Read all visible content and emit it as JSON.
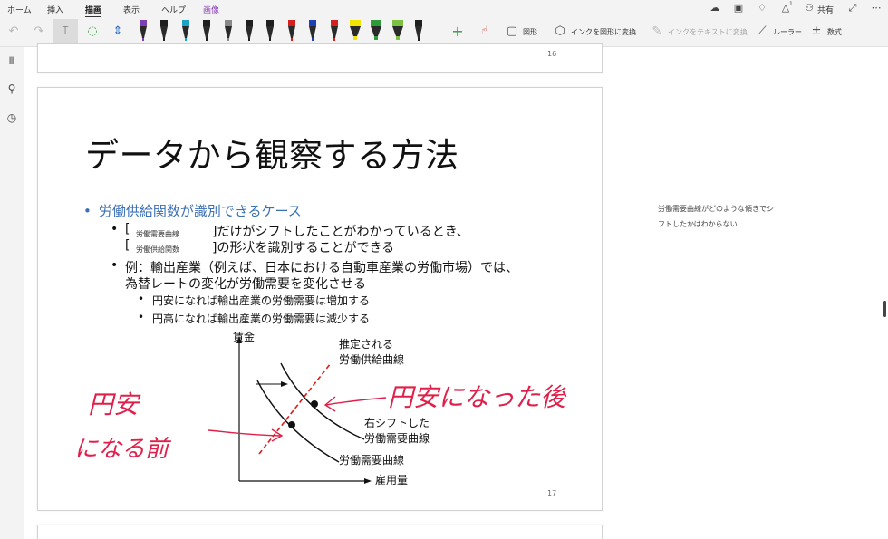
{
  "ribbon": {
    "tabs": [
      "ホーム",
      "挿入",
      "描画",
      "表示",
      "ヘルプ",
      "画像"
    ],
    "active_tab": "描画",
    "share_label": "共有",
    "notification_count": "1"
  },
  "toolbar": {
    "shapes_label": "図形",
    "ink_to_shape_label": "インクを図形に変換",
    "ink_to_text_label": "インクをテキストに変換",
    "ruler_label": "ルーラー",
    "math_label": "数式",
    "pens": [
      {
        "color": "#7e3fb5"
      },
      {
        "color": "#1f1f1f"
      },
      {
        "color": "#1aa3c4"
      },
      {
        "color": "#1f1f1f"
      },
      {
        "color": "#888888"
      },
      {
        "color": "#1f1f1f"
      },
      {
        "color": "#1f1f1f"
      },
      {
        "color": "#d62020"
      },
      {
        "color": "#1f3fb8"
      },
      {
        "color": "#d62020"
      },
      {
        "color": "#f0e400"
      },
      {
        "color": "#2f9a3a"
      },
      {
        "color": "#7bc242"
      },
      {
        "color": "#1f1f1f"
      }
    ]
  },
  "slides": {
    "prev_number": "16",
    "current": {
      "number": "17",
      "title": "データから観察する方法",
      "bullet": "労働供給関数が識別できるケース",
      "sub1_bracket_open": "[",
      "sub1_fill": "労働需要曲線",
      "sub1_text": "]だけがシフトしたことがわかっているとき、",
      "sub2_bracket_open": "[",
      "sub2_fill": "労働供給関数",
      "sub2_text": "]の形状を識別することができる",
      "sub3_line1": "例：輸出産業（例えば、日本における自動車産業の労働市場）では、",
      "sub3_line2": "為替レートの変化が労働需要を変化させる",
      "subsub1": "円安になれば輸出産業の労働需要は増加する",
      "subsub2": "円高になれば輸出産業の労働需要は減少する",
      "chart": {
        "y_axis_label": "賃金",
        "x_axis_label": "雇用量",
        "supply_label_line1": "推定される",
        "supply_label_line2": "労働供給曲線",
        "shifted_label_line1": "右シフトした",
        "shifted_label_line2": "労働需要曲線",
        "demand_label": "労働需要曲線"
      },
      "handwriting": {
        "left_line1": "円安",
        "left_line2": "になる前",
        "right": "円安になった後"
      }
    }
  },
  "notes": {
    "text": "労働需要曲線がどのような傾きでシフトしたかはわからない"
  },
  "colors": {
    "bullet_blue": "#3b6fb6",
    "ink_red": "#e0204a",
    "dashed_red": "#e01a1a"
  }
}
